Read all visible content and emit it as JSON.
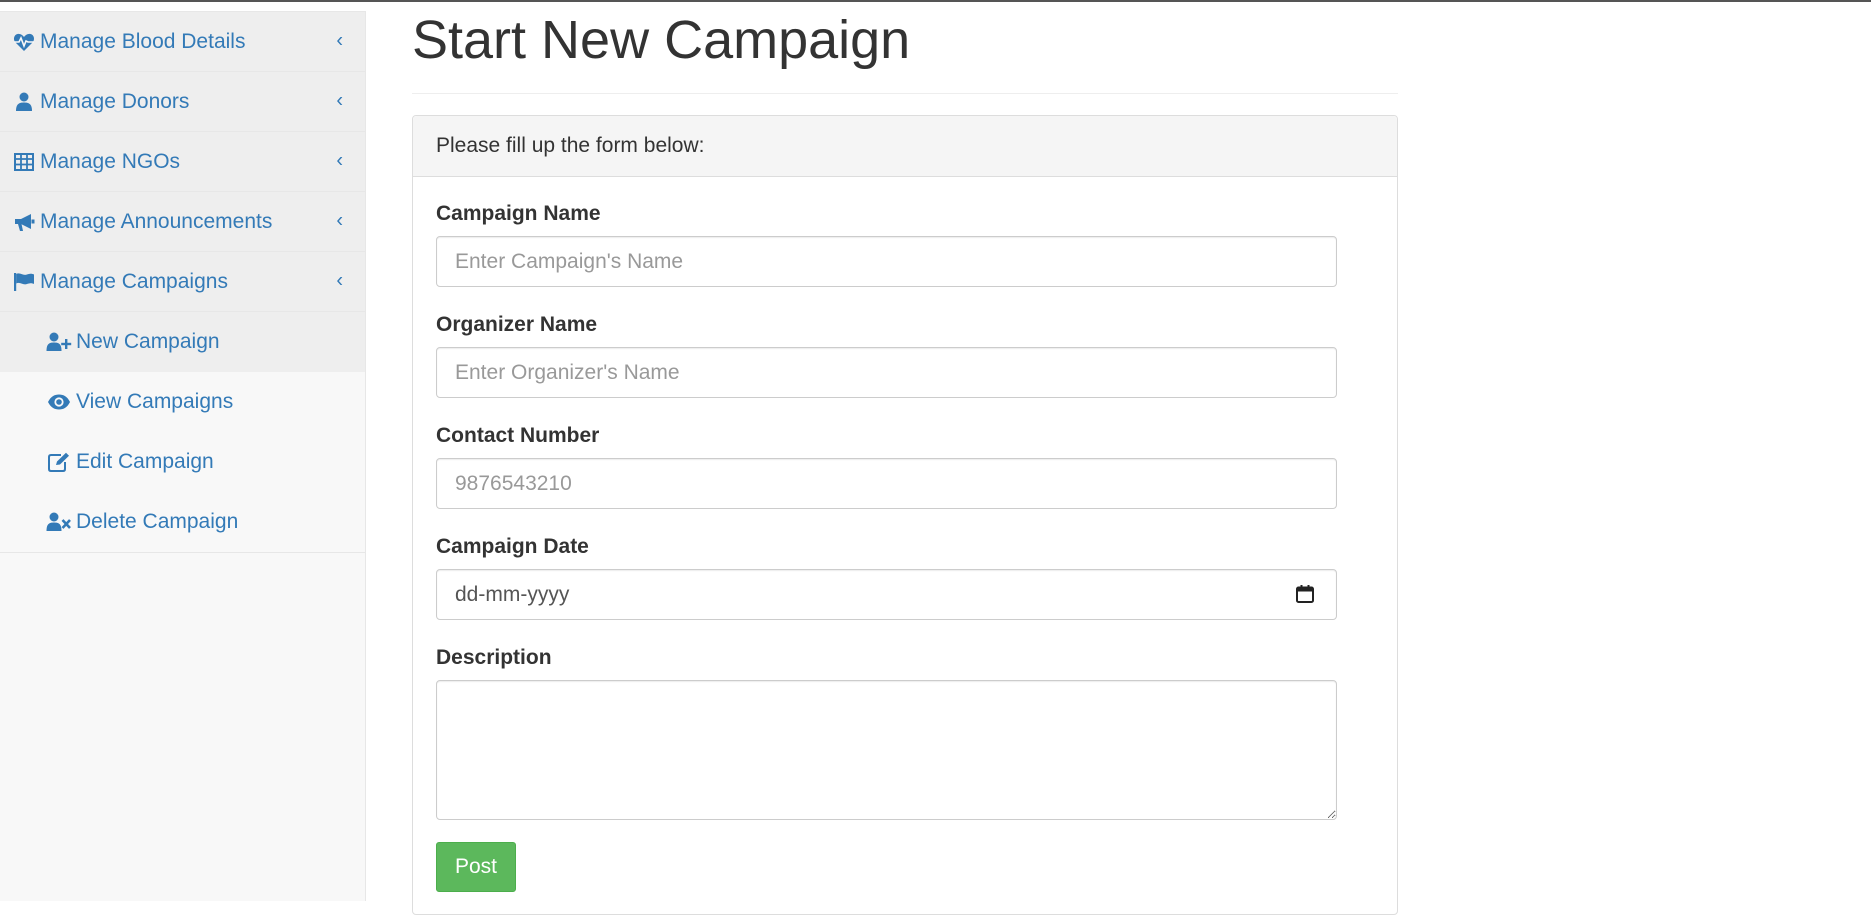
{
  "sidebar": {
    "items": [
      {
        "label": "Manage Blood Details",
        "icon": "heartbeat-icon"
      },
      {
        "label": "Manage Donors",
        "icon": "user-icon"
      },
      {
        "label": "Manage NGOs",
        "icon": "table-icon"
      },
      {
        "label": "Manage Announcements",
        "icon": "bullhorn-icon"
      },
      {
        "label": "Manage Campaigns",
        "icon": "flag-icon"
      }
    ],
    "submenu": [
      {
        "label": "New Campaign",
        "icon": "user-plus-icon"
      },
      {
        "label": "View Campaigns",
        "icon": "eye-icon"
      },
      {
        "label": "Edit Campaign",
        "icon": "edit-icon"
      },
      {
        "label": "Delete Campaign",
        "icon": "user-times-icon"
      }
    ],
    "chevron": "‹"
  },
  "main": {
    "title": "Start New Campaign",
    "panel_heading": "Please fill up the form below:",
    "form": {
      "campaign_name": {
        "label": "Campaign Name",
        "placeholder": "Enter Campaign's Name",
        "value": ""
      },
      "organizer_name": {
        "label": "Organizer Name",
        "placeholder": "Enter Organizer's Name",
        "value": ""
      },
      "contact_number": {
        "label": "Contact Number",
        "placeholder": "9876543210",
        "value": ""
      },
      "campaign_date": {
        "label": "Campaign Date",
        "placeholder": "dd-mm-yyyy"
      },
      "description": {
        "label": "Description",
        "value": ""
      },
      "submit_label": "Post"
    }
  },
  "colors": {
    "link": "#337ab7",
    "sidebar_bg": "#f8f8f8",
    "active_bg": "#eeeeee",
    "success": "#5cb85c",
    "panel_heading_bg": "#f5f5f5"
  }
}
